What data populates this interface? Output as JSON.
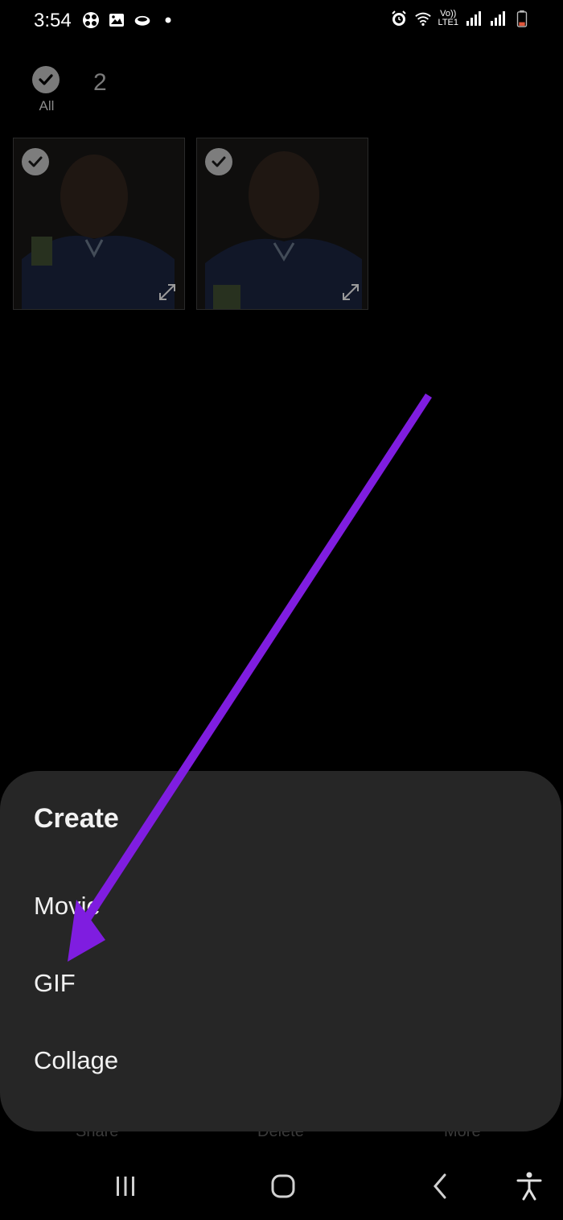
{
  "status_bar": {
    "time": "3:54",
    "lte_top": "Vo))",
    "lte_bottom": "LTE1",
    "left_icons": [
      "game-launcher-icon",
      "gallery-icon",
      "cloud-icon",
      "notification-dot-icon"
    ],
    "right_icons": [
      "alarm-icon",
      "wifi-icon",
      "signal-icon",
      "battery-icon"
    ]
  },
  "selection": {
    "all_label": "All",
    "count": "2"
  },
  "thumbnails": [
    {
      "name": "photo-1"
    },
    {
      "name": "photo-2"
    }
  ],
  "hidden_actions": {
    "share": "Share",
    "delete": "Delete",
    "more": "More"
  },
  "create_sheet": {
    "title": "Create",
    "items": [
      {
        "label": "Movie"
      },
      {
        "label": "GIF"
      },
      {
        "label": "Collage"
      }
    ]
  },
  "nav_bar": {
    "buttons": [
      "recents-icon",
      "home-icon",
      "back-icon",
      "accessibility-icon"
    ]
  },
  "colors": {
    "background": "#000000",
    "sheet": "#262626",
    "annotation_arrow": "#7f1de0"
  }
}
